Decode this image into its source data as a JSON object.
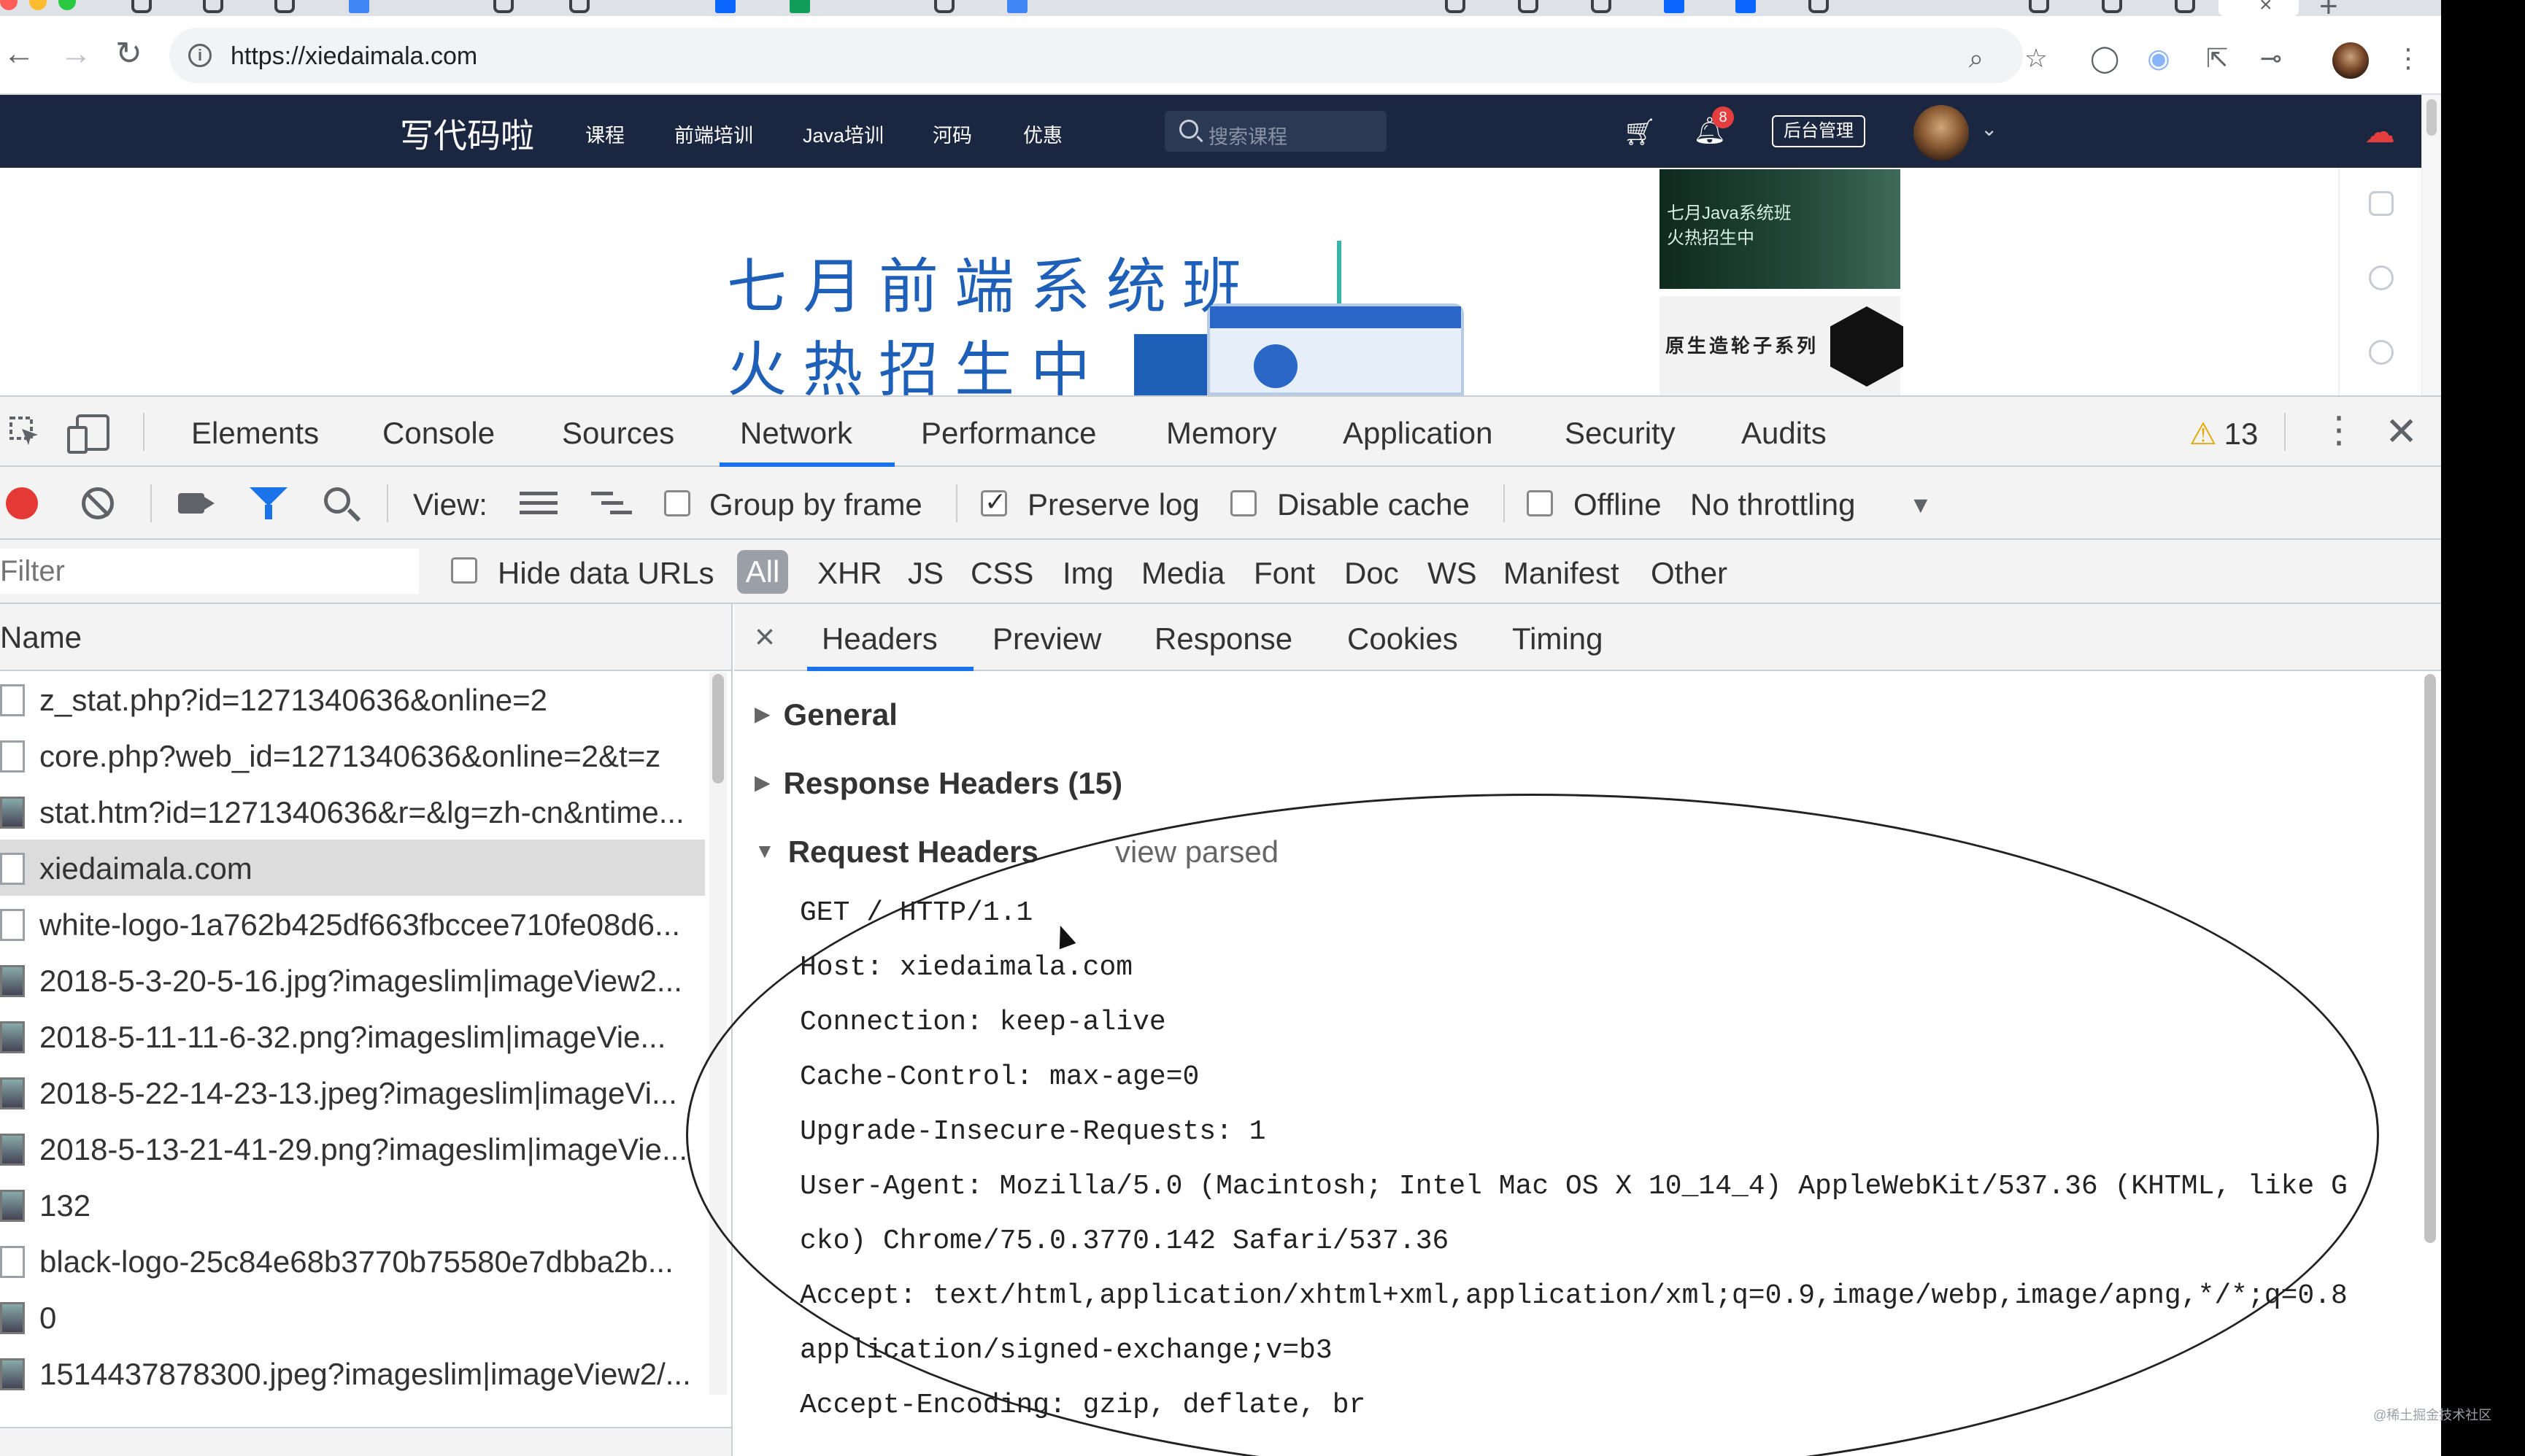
{
  "browser": {
    "url": "https://xiedaimala.com",
    "tab_close": "×",
    "new_tab": "+"
  },
  "site": {
    "logo": "写代码啦",
    "nav": [
      "课程",
      "前端培训",
      "Java培训",
      "河码",
      "优惠"
    ],
    "search_placeholder": "搜索课程",
    "bell_badge": "8",
    "admin_button": "后台管理",
    "banner_line1": "七月前端系统班",
    "banner_line2": "火热招生中",
    "ad1_text": "七月Java系统班\n火热招生中",
    "ad2_text": "原生造轮子系列"
  },
  "devtools": {
    "tabs": [
      "Elements",
      "Console",
      "Sources",
      "Network",
      "Performance",
      "Memory",
      "Application",
      "Security",
      "Audits"
    ],
    "active_tab": "Network",
    "warning_icon": "⚠",
    "warning_count": "13",
    "toolbar": {
      "view_label": "View:",
      "group_by_frame": "Group by frame",
      "preserve_log": "Preserve log",
      "disable_cache": "Disable cache",
      "offline": "Offline",
      "throttling": "No throttling"
    },
    "filter": {
      "placeholder": "Filter",
      "hide_data_urls": "Hide data URLs",
      "types": [
        "All",
        "XHR",
        "JS",
        "CSS",
        "Img",
        "Media",
        "Font",
        "Doc",
        "WS",
        "Manifest",
        "Other"
      ]
    },
    "request_list": {
      "header": "Name",
      "rows": [
        "z_stat.php?id=1271340636&online=2",
        "core.php?web_id=1271340636&online=2&t=z",
        "stat.htm?id=1271340636&r=&lg=zh-cn&ntime...",
        "xiedaimala.com",
        "white-logo-1a762b425df663fbccee710fe08d6...",
        "2018-5-3-20-5-16.jpg?imageslim|imageView2...",
        "2018-5-11-11-6-32.png?imageslim|imageVie...",
        "2018-5-22-14-23-13.jpeg?imageslim|imageVi...",
        "2018-5-13-21-41-29.png?imageslim|imageVie...",
        "132",
        "black-logo-25c84e68b3770b75580e7dbba2b...",
        "0",
        "1514437878300.jpeg?imageslim|imageView2/..."
      ],
      "selected_index": 3
    },
    "detail": {
      "close": "×",
      "tabs": [
        "Headers",
        "Preview",
        "Response",
        "Cookies",
        "Timing"
      ],
      "active_tab": "Headers",
      "sections": {
        "general": "General",
        "response_headers": "Response Headers (15)",
        "request_headers": "Request Headers",
        "view_parsed": "view parsed"
      },
      "request_header_lines": [
        "GET / HTTP/1.1",
        "Host: xiedaimala.com",
        "Connection: keep-alive",
        "Cache-Control: max-age=0",
        "Upgrade-Insecure-Requests: 1",
        "User-Agent: Mozilla/5.0 (Macintosh; Intel Mac OS X 10_14_4) AppleWebKit/537.36 (KHTML, like G",
        "cko) Chrome/75.0.3770.142 Safari/537.36",
        "Accept: text/html,application/xhtml+xml,application/xml;q=0.9,image/webp,image/apng,*/*;q=0.8",
        "application/signed-exchange;v=b3",
        "Accept-Encoding: gzip, deflate, br"
      ]
    }
  },
  "watermark": "@稀土掘金技术社区"
}
